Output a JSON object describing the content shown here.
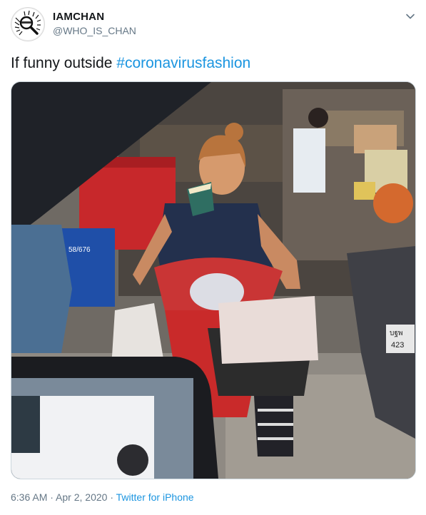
{
  "tweet": {
    "author_name": "IAMCHAN",
    "author_handle": "@WHO_IS_CHAN",
    "text_prefix": "If funny outside ",
    "hashtag": "#coronavirusfashion",
    "time": "6:36 AM",
    "separator": " · ",
    "date": "Apr 2, 2020",
    "source": "Twitter for iPhone"
  },
  "media": {
    "description_icon": "photo",
    "sign_text": "58/676",
    "plate_line1": "บฐพ",
    "plate_line2": "423"
  },
  "colors": {
    "link": "#1b95e0",
    "secondary_text": "#657786",
    "primary_text": "#14171a"
  },
  "icons": {
    "menu": "chevron-down-icon",
    "avatar": "magnifier-logo"
  }
}
